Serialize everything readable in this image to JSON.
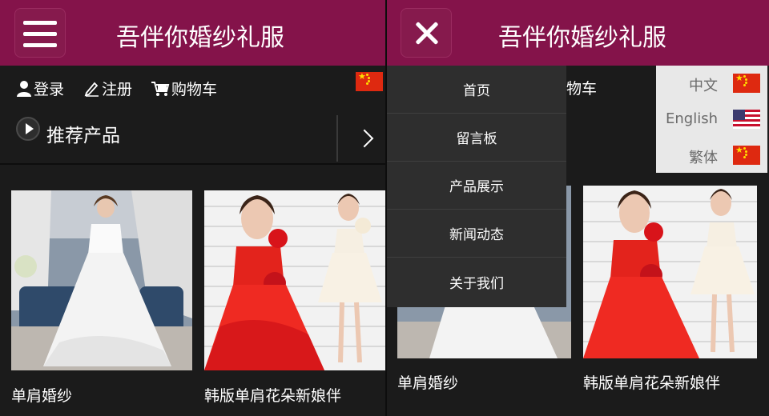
{
  "app": {
    "title": "吾伴你婚纱礼服",
    "brand_color": "#84134a"
  },
  "userbar": {
    "login": "登录",
    "register": "注册",
    "cart": "购物车",
    "cart_partial": "物车"
  },
  "section": {
    "title": "推荐产品"
  },
  "products": [
    {
      "name": "单肩婚纱"
    },
    {
      "name": "韩版单肩花朵新娘伴"
    }
  ],
  "menu": {
    "items": [
      {
        "label": "首页"
      },
      {
        "label": "留言板"
      },
      {
        "label": "产品展示"
      },
      {
        "label": "新闻动态"
      },
      {
        "label": "关于我们"
      }
    ]
  },
  "languages": [
    {
      "label": "中文",
      "flag": "flag-cn"
    },
    {
      "label": "English",
      "flag": "flag-us"
    },
    {
      "label": "繁体",
      "flag": "flag-cn"
    }
  ]
}
